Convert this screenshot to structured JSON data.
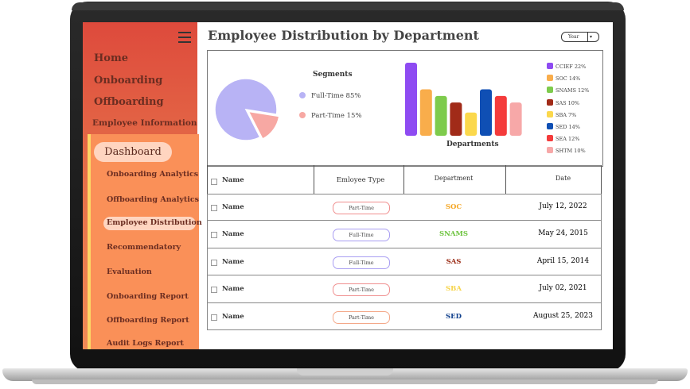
{
  "sidebar": {
    "top_items": [
      "Home",
      "Onboarding",
      "Offboarding",
      "Employee Information"
    ],
    "dashboard_label": "Dashboard",
    "sub_items": [
      "Onboarding Analytics",
      "Offboarding Analytics",
      "Employee Distribution",
      "Recommendatory",
      "Evaluation",
      "Onboarding Report",
      "Offboarding Report",
      "Audit Logs Report"
    ],
    "active_item": "Employee Distribution"
  },
  "header": {
    "title": "Employee Distribution by Department",
    "period_select": "Year"
  },
  "segments": {
    "title": "Segments",
    "items": [
      {
        "label": "Full-Time 85%",
        "color": "#b8b3f5"
      },
      {
        "label": "Part-Time 15%",
        "color": "#f7a8a3"
      }
    ]
  },
  "departments_label": "Departments",
  "chart_data": [
    {
      "type": "pie",
      "labels": [
        "Full-Time",
        "Part-Time"
      ],
      "values": [
        85,
        15
      ],
      "colors": [
        "#b8b3f5",
        "#f7a8a3"
      ]
    },
    {
      "type": "bar",
      "categories": [
        "CCIEF",
        "SOC",
        "SNAMS",
        "SAS",
        "SBA",
        "SED",
        "SEA",
        "SHTM"
      ],
      "values": [
        22,
        14,
        12,
        10,
        7,
        14,
        12,
        10
      ],
      "legend": [
        "CCIEF 22%",
        "SOC 14%",
        "SNAMS 12%",
        "SAS 10%",
        "SBA 7%",
        "SED 14%",
        "SEA 12%",
        "SHTM 10%"
      ],
      "colors": [
        "#8e4bf2",
        "#f9ad4b",
        "#7ecb4c",
        "#a12b18",
        "#fbd84c",
        "#0f4fb4",
        "#f43b3b",
        "#f7a8a8"
      ],
      "xlabel": "Departments",
      "ylim": [
        0,
        22
      ]
    }
  ],
  "table": {
    "headers": [
      "Name",
      "Emloyee Type",
      "Department",
      "Date"
    ],
    "rows": [
      {
        "name": "Name",
        "type": "Part-Time",
        "type_color": "#f08f8f",
        "dept": "SOC",
        "dept_color": "#f5a623",
        "date": "July 12, 2022"
      },
      {
        "name": "Name",
        "type": "Full-Time",
        "type_color": "#a99ef2",
        "dept": "SNAMS",
        "dept_color": "#6cc33d",
        "date": "May 24, 2015"
      },
      {
        "name": "Name",
        "type": "Full-Time",
        "type_color": "#a99ef2",
        "dept": "SAS",
        "dept_color": "#9a2a14",
        "date": "April 15, 2014"
      },
      {
        "name": "Name",
        "type": "Part-Time",
        "type_color": "#f08f8f",
        "dept": "SBA",
        "dept_color": "#f6d44a",
        "date": "July 02, 2021"
      },
      {
        "name": "Name",
        "type": "Part-Time",
        "type_color": "#f4a98a",
        "dept": "SED",
        "dept_color": "#0f3f8c",
        "date": "August 25, 2023"
      }
    ]
  }
}
